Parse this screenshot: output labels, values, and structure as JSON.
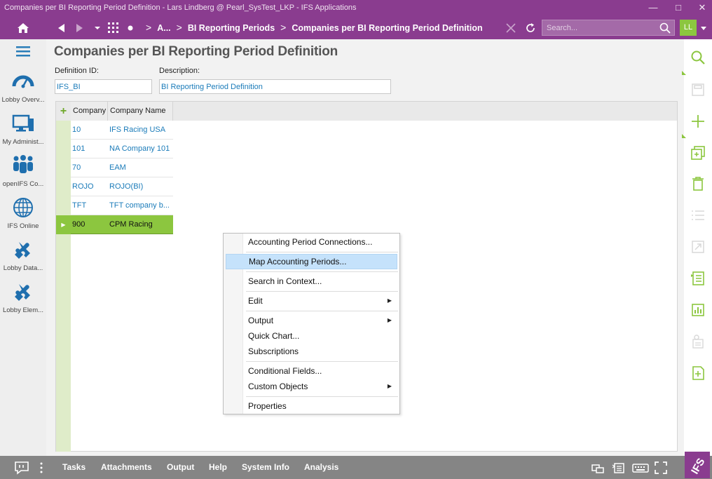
{
  "window": {
    "title": "Companies per BI Reporting Period Definition - Lars Lindberg @ Pearl_SysTest_LKP - IFS Applications",
    "minimize": "—",
    "maximize": "□",
    "close": "✕"
  },
  "navbar": {
    "breadcrumbs": [
      "A...",
      "BI Reporting Periods",
      "Companies per BI Reporting Period Definition"
    ],
    "search_placeholder": "Search...",
    "user_initials": "LL"
  },
  "sidebar": {
    "items": [
      {
        "label": "Lobby Overv...",
        "icon": "gauge-icon"
      },
      {
        "label": "My Administ...",
        "icon": "monitor-icon"
      },
      {
        "label": "openIFS Co...",
        "icon": "people-icon"
      },
      {
        "label": "IFS Online",
        "icon": "globe-icon"
      },
      {
        "label": "Lobby Data...",
        "icon": "puzzle-icon"
      },
      {
        "label": "Lobby Elem...",
        "icon": "puzzle-icon"
      }
    ]
  },
  "page": {
    "title": "Companies per BI Reporting Period Definition",
    "definition_id_label": "Definition ID:",
    "definition_id_value": "IFS_BI",
    "description_label": "Description:",
    "description_value": "BI Reporting Period Definition"
  },
  "grid": {
    "add_symbol": "+",
    "columns": [
      "Company",
      "Company Name"
    ],
    "rows": [
      {
        "company": "10",
        "name": "IFS Racing USA",
        "selected": false
      },
      {
        "company": "101",
        "name": "NA Company 101",
        "selected": false
      },
      {
        "company": "70",
        "name": "EAM",
        "selected": false
      },
      {
        "company": "ROJO",
        "name": "ROJO(BI)",
        "selected": false
      },
      {
        "company": "TFT",
        "name": "TFT company b...",
        "selected": false
      },
      {
        "company": "900",
        "name": "CPM Racing",
        "selected": true
      }
    ],
    "selection_marker": "▶"
  },
  "context_menu": {
    "items": [
      {
        "label": "Accounting Period Connections...",
        "submenu": false,
        "highlighted": false
      },
      {
        "label": "Map Accounting Periods...",
        "submenu": false,
        "highlighted": true
      },
      {
        "label": "Search in Context...",
        "submenu": false,
        "highlighted": false
      },
      {
        "label": "Edit",
        "submenu": true,
        "highlighted": false
      },
      {
        "label": "Output",
        "submenu": true,
        "highlighted": false
      },
      {
        "label": "Quick Chart...",
        "submenu": false,
        "highlighted": false
      },
      {
        "label": "Subscriptions",
        "submenu": false,
        "highlighted": false
      },
      {
        "label": "Conditional Fields...",
        "submenu": false,
        "highlighted": false
      },
      {
        "label": "Custom Objects",
        "submenu": true,
        "highlighted": false
      },
      {
        "label": "Properties",
        "submenu": false,
        "highlighted": false
      }
    ],
    "submenu_arrow": "▶"
  },
  "bottombar": {
    "items": [
      "Tasks",
      "Attachments",
      "Output",
      "Help",
      "System Info",
      "Analysis"
    ]
  },
  "colors": {
    "brand_purple": "#8a3c8f",
    "selection_green": "#8cc63f",
    "link_blue": "#1a7bb9",
    "menu_highlight": "#c5e2fb"
  }
}
